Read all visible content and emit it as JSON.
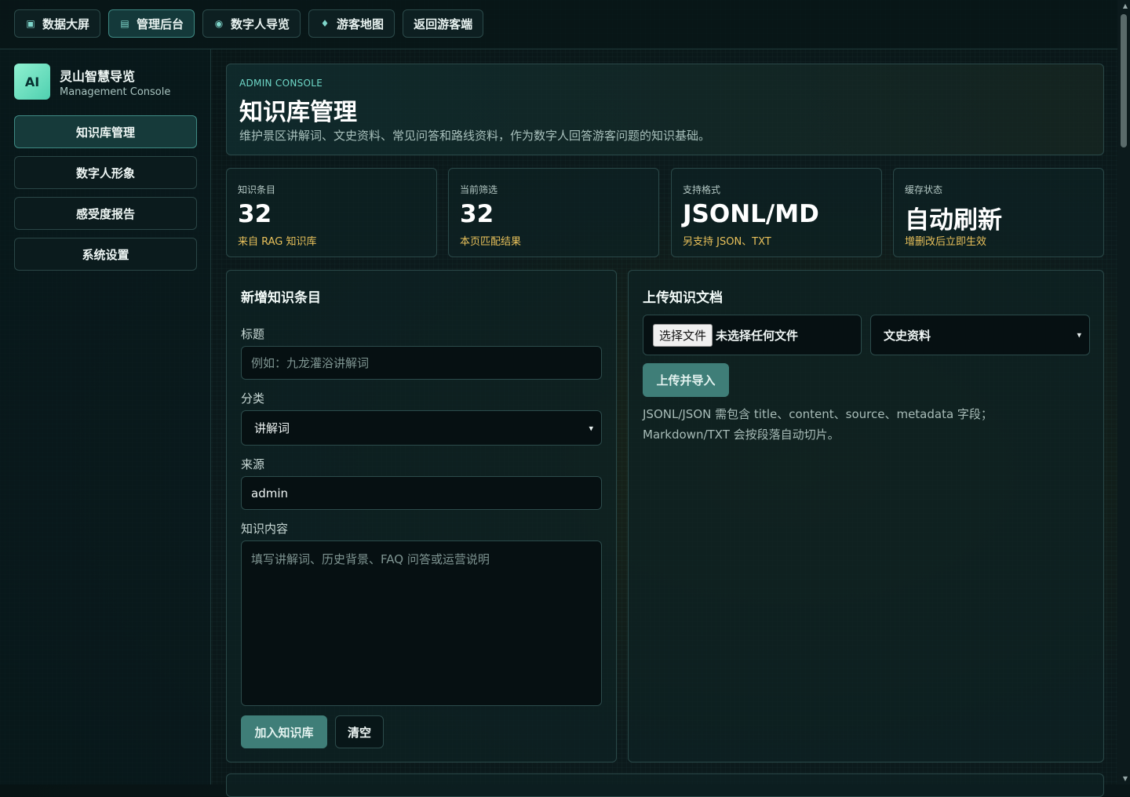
{
  "topnav": [
    {
      "label": "数据大屏",
      "icon": "screen-icon",
      "glyph": "▣",
      "active": false
    },
    {
      "label": "管理后台",
      "icon": "list-icon",
      "glyph": "▤",
      "active": true
    },
    {
      "label": "数字人导览",
      "icon": "radio-icon",
      "glyph": "◉",
      "active": false
    },
    {
      "label": "游客地图",
      "icon": "pin-icon",
      "glyph": "♦",
      "active": false
    },
    {
      "label": "返回游客端",
      "icon": "",
      "glyph": "",
      "active": false
    }
  ],
  "brand": {
    "logo": "AI",
    "title": "灵山智慧导览",
    "subtitle": "Management Console"
  },
  "sidebar": {
    "items": [
      {
        "label": "知识库管理",
        "active": true
      },
      {
        "label": "数字人形象",
        "active": false
      },
      {
        "label": "感受度报告",
        "active": false
      },
      {
        "label": "系统设置",
        "active": false
      }
    ]
  },
  "header": {
    "eyebrow": "ADMIN CONSOLE",
    "title": "知识库管理",
    "description": "维护景区讲解词、文史资料、常见问答和路线资料，作为数字人回答游客问题的知识基础。"
  },
  "stats": [
    {
      "label": "知识条目",
      "value": "32",
      "note": "来自 RAG 知识库"
    },
    {
      "label": "当前筛选",
      "value": "32",
      "note": "本页匹配结果"
    },
    {
      "label": "支持格式",
      "value": "JSONL/MD",
      "note": "另支持 JSON、TXT"
    },
    {
      "label": "缓存状态",
      "value": "自动刷新",
      "note": "增删改后立即生效"
    }
  ],
  "add_form": {
    "title": "新增知识条目",
    "title_label": "标题",
    "title_placeholder": "例如：九龙灌浴讲解词",
    "category_label": "分类",
    "category_value": "讲解词",
    "source_label": "来源",
    "source_value": "admin",
    "content_label": "知识内容",
    "content_placeholder": "填写讲解词、历史背景、FAQ 问答或运营说明",
    "submit_label": "加入知识库",
    "clear_label": "清空"
  },
  "upload": {
    "title": "上传知识文档",
    "file_button": "选择文件",
    "file_status": "未选择任何文件",
    "category_value": "文史资料",
    "submit_label": "上传并导入",
    "hint_line1": "JSONL/JSON 需包含 title、content、source、metadata 字段；",
    "hint_line2": "Markdown/TXT 会按段落自动切片。"
  },
  "colors": {
    "accent": "#6fd8c8",
    "note": "#e8c05a",
    "primary_button": "#3f7e78"
  }
}
